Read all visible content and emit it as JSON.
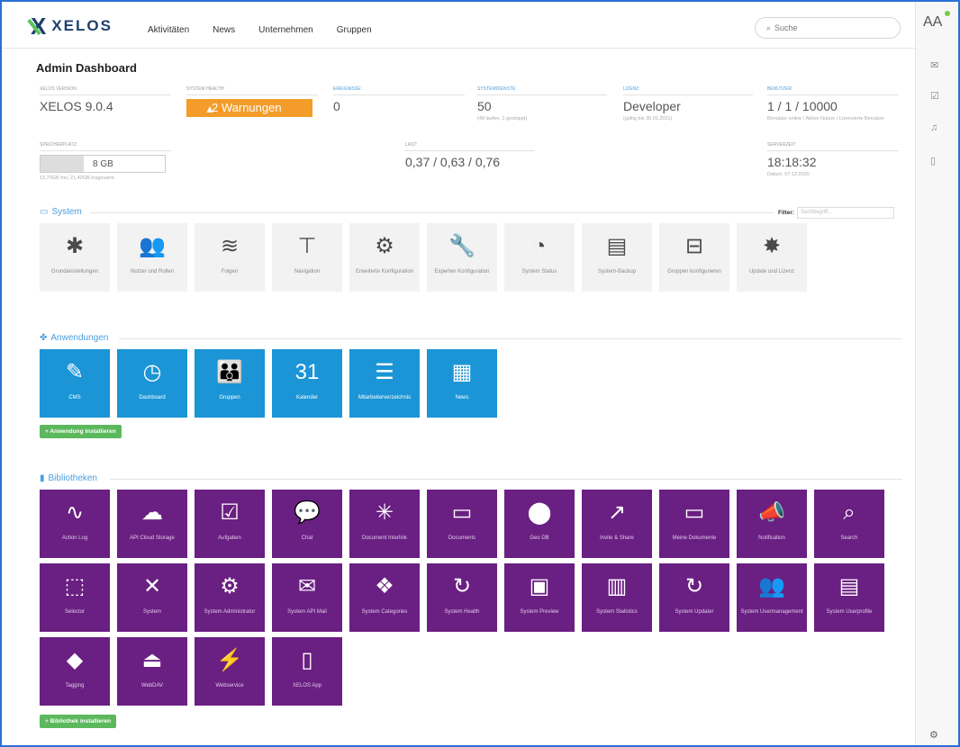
{
  "brand": {
    "name": "XELOS"
  },
  "nav": [
    "Aktivitäten",
    "News",
    "Unternehmen",
    "Gruppen"
  ],
  "search": {
    "placeholder": "Suche"
  },
  "user": {
    "initials": "AA"
  },
  "page_title": "Admin Dashboard",
  "stats": {
    "version": {
      "label": "XELOS Version:",
      "value": "XELOS 9.0.4"
    },
    "health": {
      "label": "System Health:",
      "value": "2 Warnungen"
    },
    "events": {
      "label": "Ereignisse:",
      "value": "0"
    },
    "services": {
      "label": "Systemdienste:",
      "value": "50",
      "sub": "(49 laufen, 1 gestoppt)"
    },
    "license": {
      "label": "Lizenz:",
      "value": "Developer",
      "sub": "(gültig bis 30.01.2021)"
    },
    "users": {
      "label": "Benutzer:",
      "value": "1 / 1 / 10000",
      "sub": "Benutzer online / Aktive Nutzer / Lizenzierte Benutzer"
    },
    "storage": {
      "label": "Speicherplatz:",
      "value": "8 GB",
      "sub": "13,70GB frei, 21,40GB insgesamt"
    },
    "load": {
      "label": "Last:",
      "value": "0,37 / 0,63 / 0,76"
    },
    "server_time": {
      "label": "Serverzeit:",
      "value": "18:18:32",
      "sub": "Datum: 07.12.2020"
    }
  },
  "filter": {
    "label": "Filter:",
    "placeholder": "Suchbegriff..."
  },
  "sections": {
    "system": "System",
    "apps": "Anwendungen",
    "libs": "Bibliotheken"
  },
  "system_tiles": [
    {
      "label": "Grundeinstellungen",
      "icon": "✱"
    },
    {
      "label": "Nutzer und Rollen",
      "icon": "👥"
    },
    {
      "label": "Folgen",
      "icon": "≋"
    },
    {
      "label": "Navigation",
      "icon": "⊤"
    },
    {
      "label": "Erweiterte Konfiguration",
      "icon": "⚙"
    },
    {
      "label": "Experten Konfiguration",
      "icon": "🔧"
    },
    {
      "label": "System Status",
      "icon": "◔"
    },
    {
      "label": "System-Backup",
      "icon": "▤"
    },
    {
      "label": "Gruppen konfigurieren",
      "icon": "⊟"
    },
    {
      "label": "Update und Lizenz",
      "icon": "✸"
    }
  ],
  "app_tiles": [
    {
      "label": "CMS",
      "icon": "✎"
    },
    {
      "label": "Dashboard",
      "icon": "◷"
    },
    {
      "label": "Gruppen",
      "icon": "👪"
    },
    {
      "label": "Kalender",
      "icon": "31"
    },
    {
      "label": "Mitarbeiterverzeichnis",
      "icon": "☰"
    },
    {
      "label": "News",
      "icon": "▦"
    }
  ],
  "install_app": "+ Anwendung installieren",
  "lib_tiles": [
    {
      "label": "Action Log",
      "icon": "∿"
    },
    {
      "label": "API Cloud Storage",
      "icon": "☁"
    },
    {
      "label": "Aufgaben",
      "icon": "☑"
    },
    {
      "label": "Chat",
      "icon": "💬"
    },
    {
      "label": "Document Interlink",
      "icon": "✳"
    },
    {
      "label": "Documents",
      "icon": "▭"
    },
    {
      "label": "Geo DB",
      "icon": "⬤"
    },
    {
      "label": "Invite & Share",
      "icon": "↗"
    },
    {
      "label": "Meine Dokumente",
      "icon": "▭"
    },
    {
      "label": "Notification",
      "icon": "📣"
    },
    {
      "label": "Search",
      "icon": "⌕"
    },
    {
      "label": "Selector",
      "icon": "⬚"
    },
    {
      "label": "System",
      "icon": "✕"
    },
    {
      "label": "System Administrator",
      "icon": "⚙"
    },
    {
      "label": "System API Mail",
      "icon": "✉"
    },
    {
      "label": "System Categories",
      "icon": "❖"
    },
    {
      "label": "System Health",
      "icon": "↻"
    },
    {
      "label": "System Preview",
      "icon": "▣"
    },
    {
      "label": "System Statistics",
      "icon": "▥"
    },
    {
      "label": "System Updater",
      "icon": "↻"
    },
    {
      "label": "System Usermanagement",
      "icon": "👥"
    },
    {
      "label": "System Userprofile",
      "icon": "▤"
    },
    {
      "label": "Tagging",
      "icon": "◆"
    },
    {
      "label": "WebDAV",
      "icon": "⏏"
    },
    {
      "label": "Webservice",
      "icon": "⚡"
    },
    {
      "label": "XELOS App",
      "icon": "▯"
    }
  ],
  "install_lib": "+ Bibliothek installieren",
  "colors": {
    "system_tile": "#f2f2f2",
    "app_tile": "#1b95d6",
    "lib_tile": "#6a1f82",
    "warning": "#f39c2a",
    "install": "#5cb85c"
  }
}
